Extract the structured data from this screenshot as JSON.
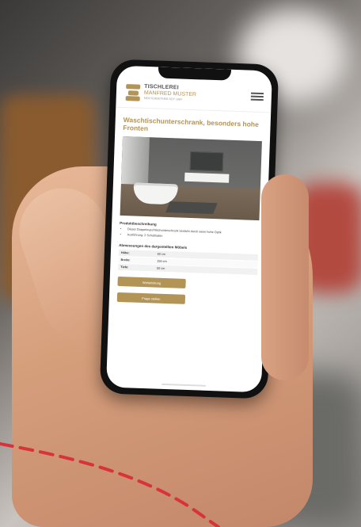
{
  "header": {
    "brand_line1": "TISCHLEREI",
    "brand_line2": "MANFRED MUSTER",
    "brand_tagline": "MEISTERBETRIEB SEIT 1984"
  },
  "page": {
    "title": "Waschtischunterschrank, besonders hohe Fronten"
  },
  "description": {
    "heading": "Produktbeschreibung",
    "bullets": [
      "Dieser Doppelwaschtischunterschrank besticht durch seine hohe Optik",
      "Ausführung: 2 Schubladen"
    ]
  },
  "dimensions": {
    "heading": "Abmessungen des dargestellten Möbels",
    "rows": [
      {
        "label": "Höhe:",
        "value": "60 cm"
      },
      {
        "label": "Breite:",
        "value": "150 cm"
      },
      {
        "label": "Tiefe:",
        "value": "50 cm"
      }
    ]
  },
  "buttons": {
    "primary": "Weiterleitung",
    "secondary": "Frage stellen"
  },
  "colors": {
    "accent": "#b39457",
    "dashed_line": "#d8333a"
  }
}
